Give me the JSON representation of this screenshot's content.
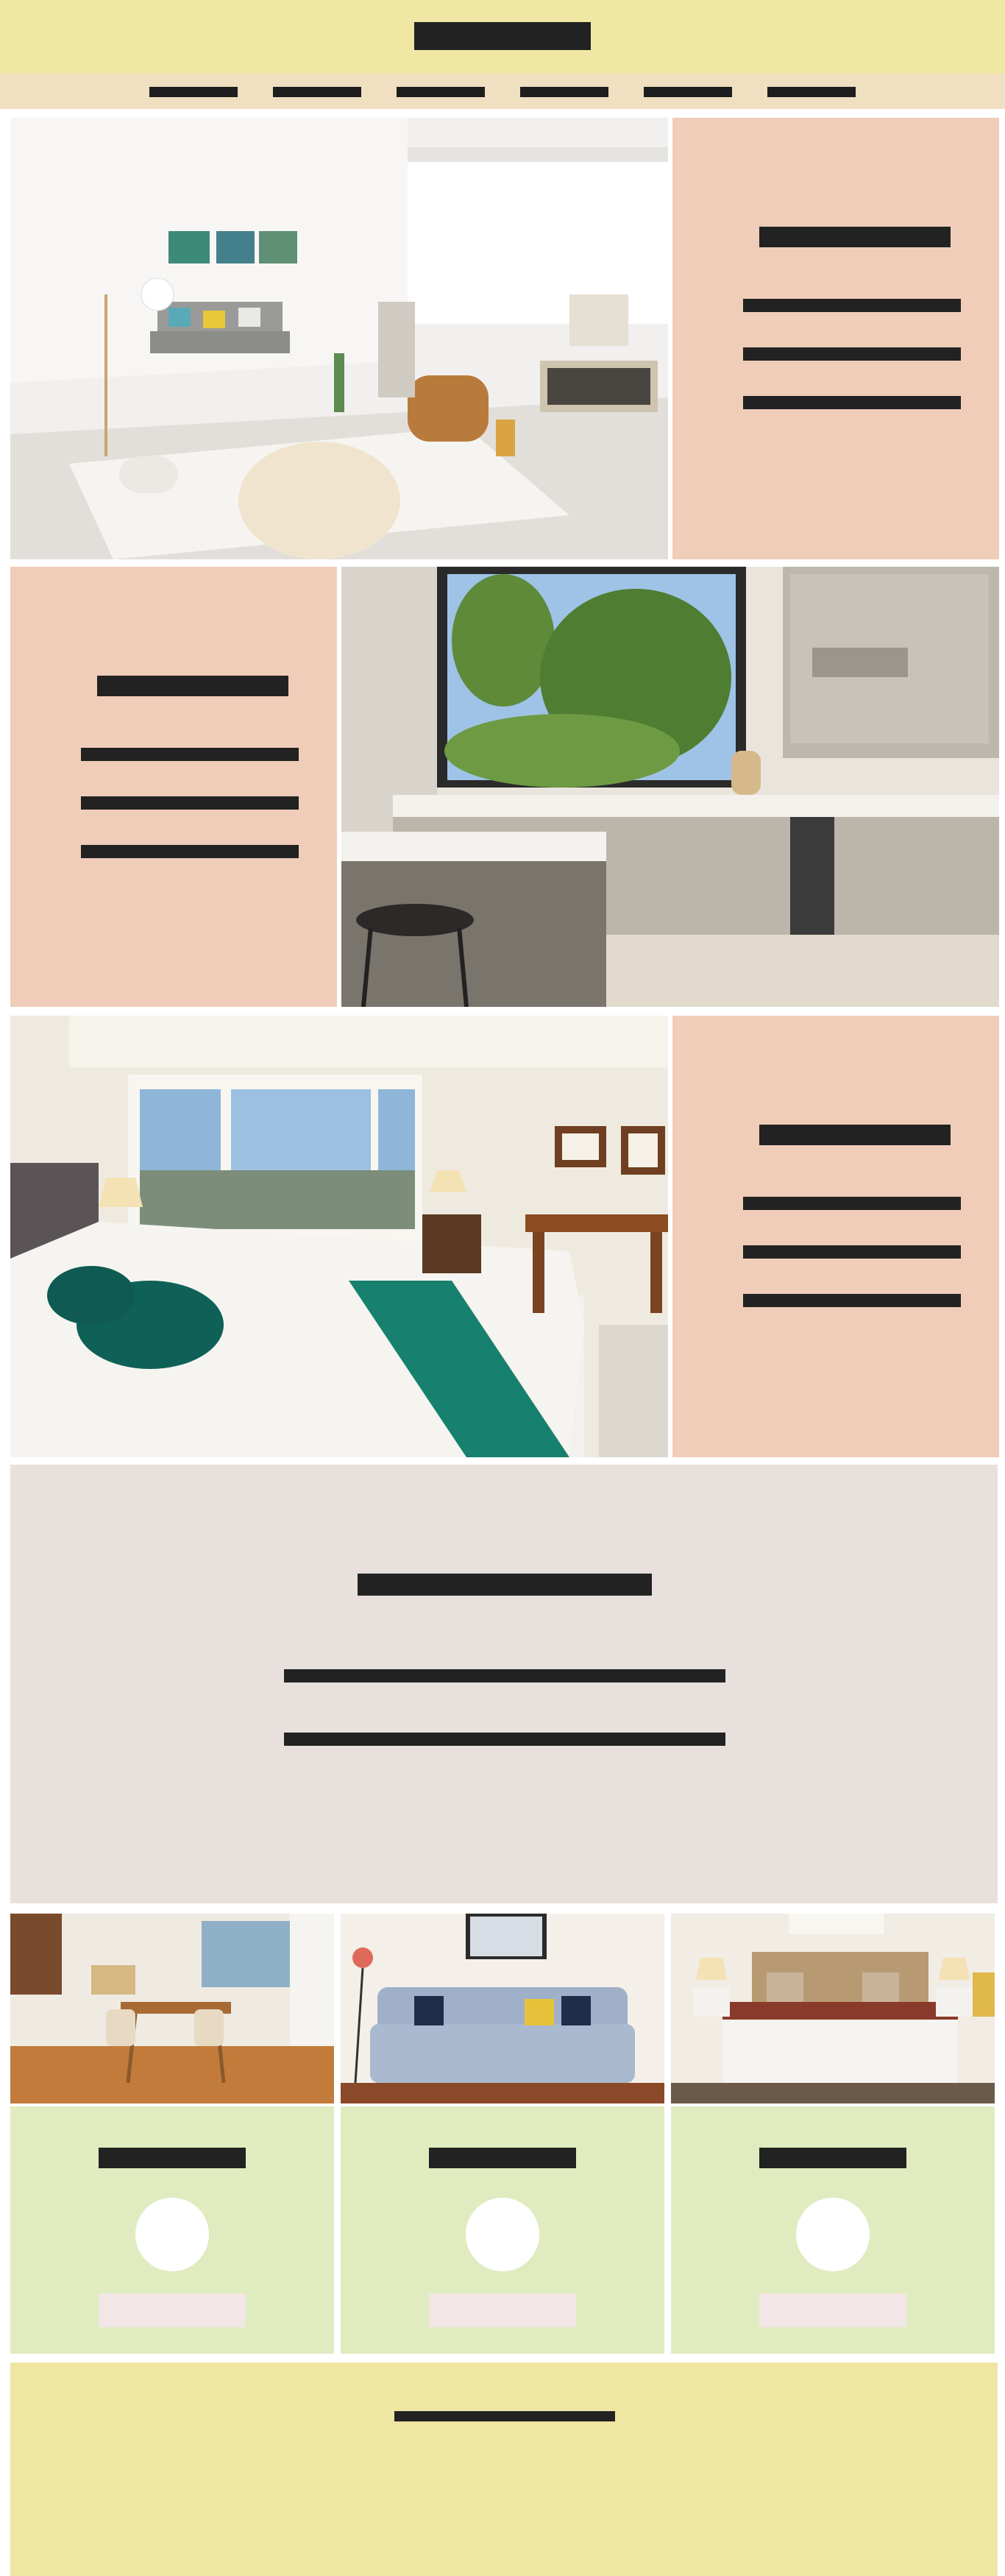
{
  "header": {
    "logo_text": ""
  },
  "nav": {
    "items": [
      "",
      "",
      "",
      "",
      "",
      ""
    ]
  },
  "features": [
    {
      "image": "living-room-photo",
      "heading": "",
      "lines": [
        "",
        "",
        ""
      ]
    },
    {
      "image": "kitchen-photo",
      "heading": "",
      "lines": [
        "",
        "",
        ""
      ]
    },
    {
      "image": "bedroom-photo",
      "heading": "",
      "lines": [
        "",
        "",
        ""
      ]
    }
  ],
  "banner": {
    "heading": "",
    "lines": [
      "",
      ""
    ]
  },
  "cards": [
    {
      "image": "dining-room-photo",
      "title": "",
      "button_label": ""
    },
    {
      "image": "sofa-photo",
      "title": "",
      "button_label": ""
    },
    {
      "image": "guest-bedroom-photo",
      "title": "",
      "button_label": ""
    }
  ],
  "footer": {
    "text": ""
  },
  "colors": {
    "header_bg": "#f0e7a4",
    "nav_bg": "#f0dfc0",
    "panel_bg": "#f0cdb8",
    "banner_bg": "#e8e0dc",
    "card_bg": "#e0ecc0",
    "button_bg": "#f2e6e6",
    "placeholder_bar": "#222222"
  }
}
